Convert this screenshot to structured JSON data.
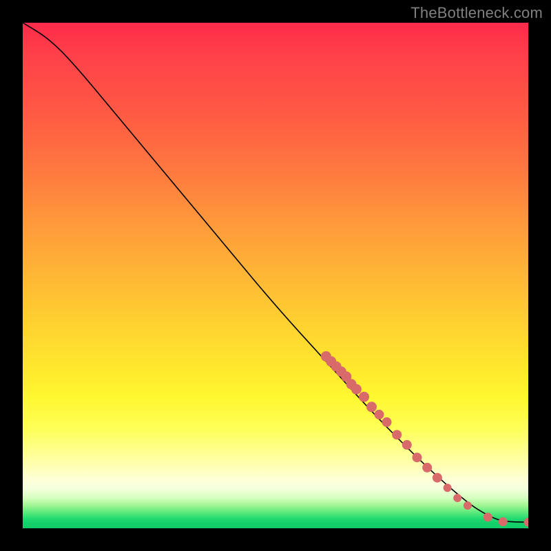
{
  "watermark": "TheBottleneck.com",
  "colors": {
    "dot": "#d86a6a",
    "curve": "#000000",
    "background_black": "#000000"
  },
  "chart_data": {
    "type": "line",
    "title": "",
    "xlabel": "",
    "ylabel": "",
    "xlim": [
      0,
      100
    ],
    "ylim": [
      0,
      100
    ],
    "note": "Axes have no tick labels; values are estimated from pixel positions on a 0–100 normalized scale. y is read with 0 at bottom.",
    "curve": [
      {
        "x": 0,
        "y": 100
      },
      {
        "x": 5,
        "y": 97
      },
      {
        "x": 10,
        "y": 92
      },
      {
        "x": 20,
        "y": 80
      },
      {
        "x": 30,
        "y": 68
      },
      {
        "x": 40,
        "y": 56
      },
      {
        "x": 50,
        "y": 44
      },
      {
        "x": 60,
        "y": 33
      },
      {
        "x": 70,
        "y": 22
      },
      {
        "x": 80,
        "y": 12
      },
      {
        "x": 88,
        "y": 5
      },
      {
        "x": 92,
        "y": 2.5
      },
      {
        "x": 95,
        "y": 1.3
      },
      {
        "x": 100,
        "y": 1.2
      }
    ],
    "series": [
      {
        "name": "highlighted-points",
        "points": [
          {
            "x": 60,
            "y": 34
          },
          {
            "x": 61,
            "y": 33
          },
          {
            "x": 62,
            "y": 32
          },
          {
            "x": 63,
            "y": 31
          },
          {
            "x": 64,
            "y": 30
          },
          {
            "x": 65,
            "y": 28.5
          },
          {
            "x": 66,
            "y": 27.5
          },
          {
            "x": 67.5,
            "y": 26
          },
          {
            "x": 69,
            "y": 24
          },
          {
            "x": 70.5,
            "y": 22.5
          },
          {
            "x": 72,
            "y": 21
          },
          {
            "x": 74,
            "y": 18.5
          },
          {
            "x": 76,
            "y": 16.5
          },
          {
            "x": 78,
            "y": 14
          },
          {
            "x": 80,
            "y": 12
          },
          {
            "x": 82,
            "y": 10
          },
          {
            "x": 84,
            "y": 8
          },
          {
            "x": 86,
            "y": 6
          },
          {
            "x": 88,
            "y": 4.5
          },
          {
            "x": 92,
            "y": 2.2
          },
          {
            "x": 95,
            "y": 1.3
          },
          {
            "x": 100,
            "y": 1.2
          }
        ]
      }
    ]
  }
}
